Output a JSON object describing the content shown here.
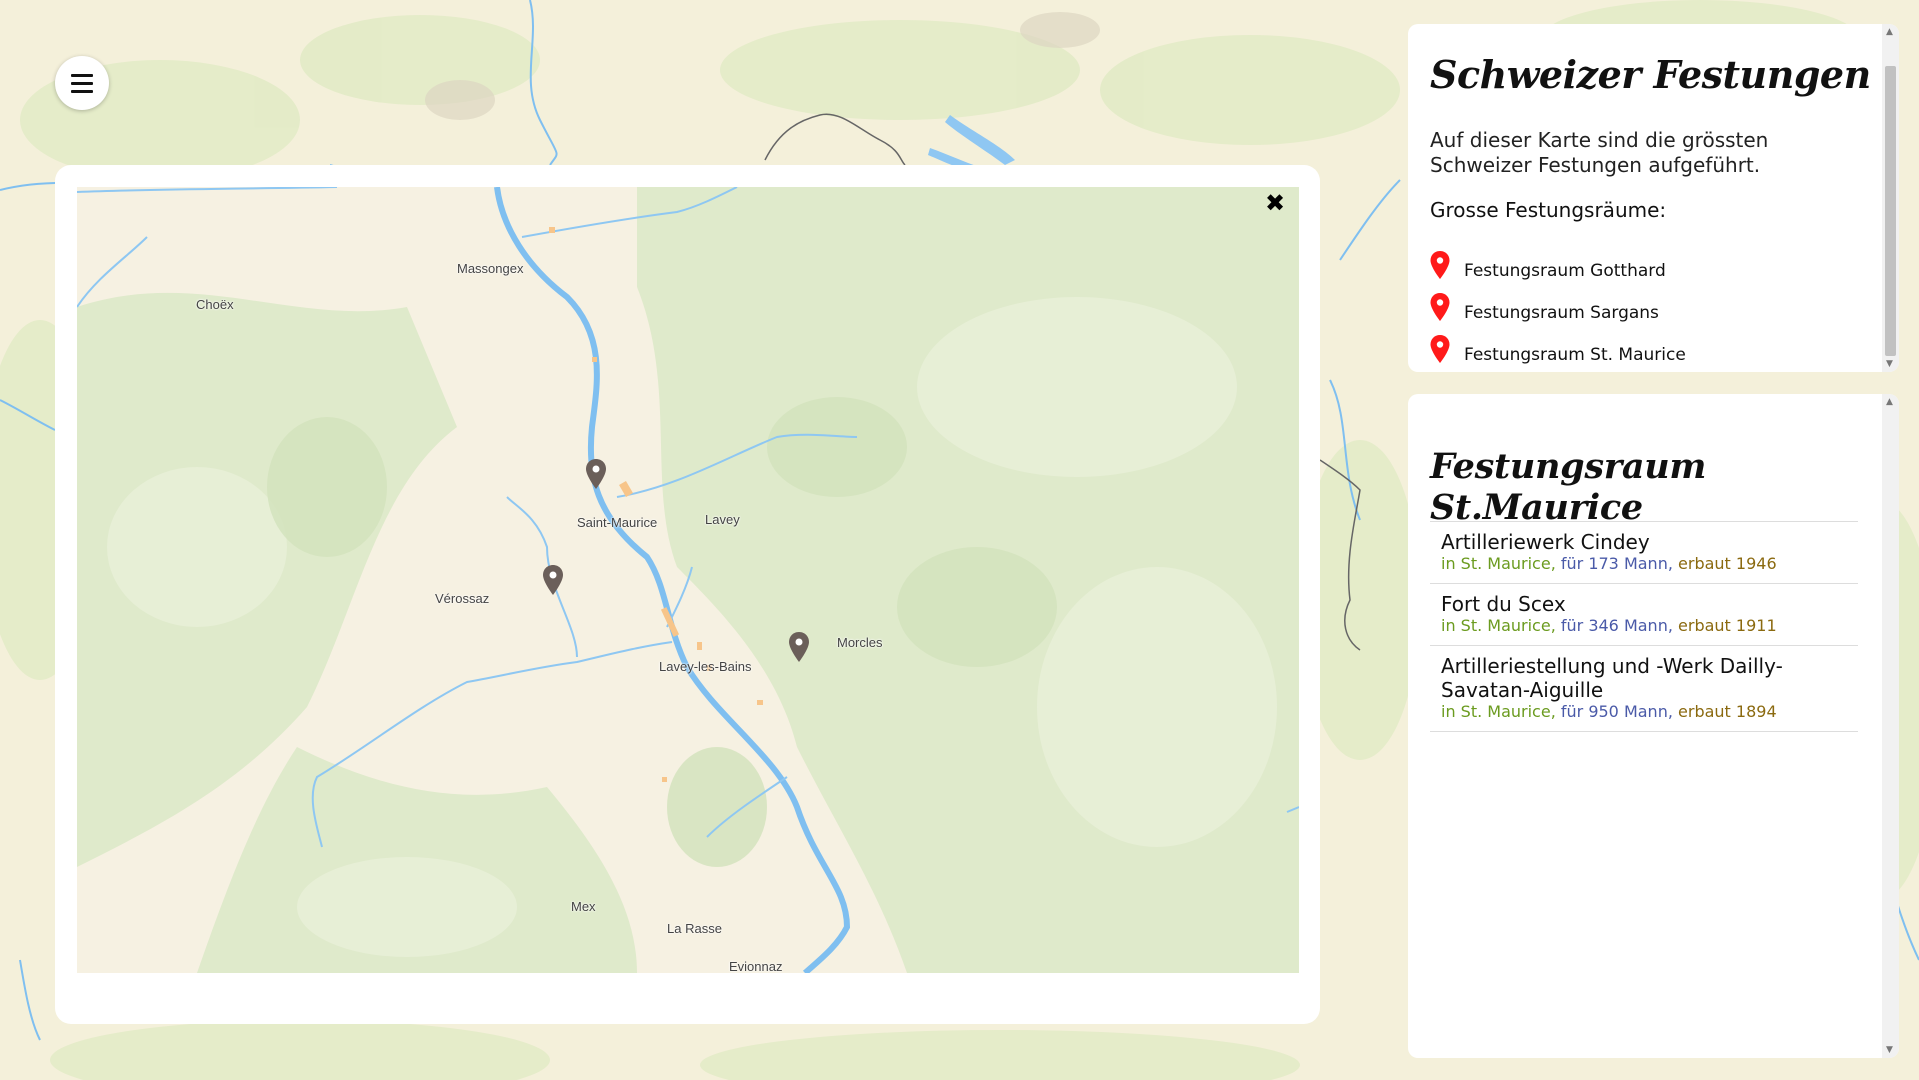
{
  "menu": {
    "icon": "hamburger-icon"
  },
  "colors": {
    "river": "#7fbff0",
    "forest": "#dbe9c8",
    "marker": "#6b5f5a",
    "legend_pin": "#ff1a1a",
    "location_text": "#6b9b1f",
    "crew_text": "#4a5aa8",
    "year_text": "#8b6a10"
  },
  "modal": {
    "close_icon": "close-icon",
    "places": {
      "massongex": "Massongex",
      "choex": "Choëx",
      "saint_maurice": "Saint-Maurice",
      "lavey": "Lavey",
      "verossaz": "Vérossaz",
      "morcles": "Morcles",
      "lavey_les_bains": "Lavey-les-Bains",
      "mex": "Mex",
      "la_rasse": "La Rasse",
      "evionnaz": "Evionnaz"
    },
    "marker_icon": "map-pin-icon"
  },
  "sidebar": {
    "title": "Schweizer Festungen",
    "intro": "Auf dieser Karte sind die grössten Schweizer Festungen aufgeführt.",
    "subheading": "Grosse Festungsräume:",
    "regions": [
      {
        "label": "Festungsraum Gotthard"
      },
      {
        "label": "Festungsraum Sargans"
      },
      {
        "label": "Festungsraum St. Maurice"
      }
    ]
  },
  "detail": {
    "title": "Festungsraum St.Maurice",
    "items": [
      {
        "name": "Artilleriewerk Cindey",
        "location": "in St. Maurice,",
        "crew": "für 173 Mann,",
        "built": "erbaut 1946"
      },
      {
        "name": "Fort du Scex",
        "location": "in St. Maurice,",
        "crew": "für 346 Mann,",
        "built": "erbaut 1911"
      },
      {
        "name": "Artilleriestellung und -Werk Dailly-Savatan-Aiguille",
        "location": "in St. Maurice,",
        "crew": "für 950 Mann,",
        "built": "erbaut 1894"
      }
    ]
  }
}
